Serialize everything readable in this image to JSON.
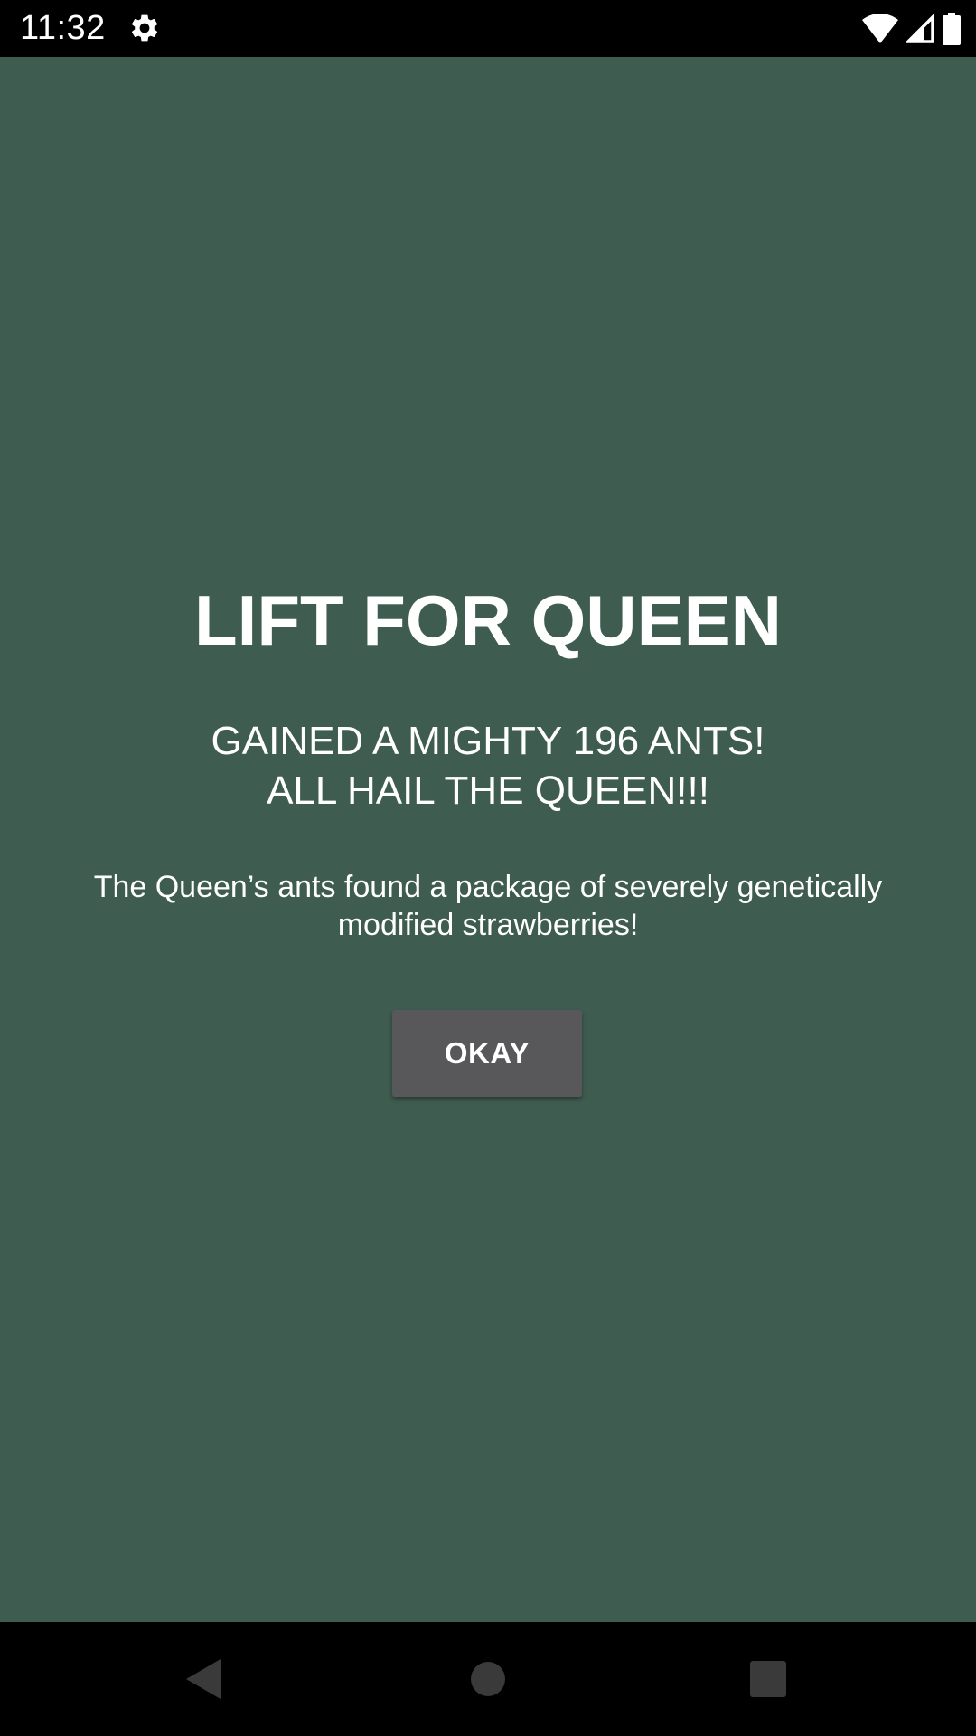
{
  "status_bar": {
    "time": "11:32",
    "icons": [
      "gear-icon",
      "wifi-icon",
      "cellular-signal-icon",
      "battery-icon"
    ]
  },
  "dialog": {
    "title": "LIFT FOR QUEEN",
    "subtitle_line1": "GAINED A MIGHTY 196 ANTS!",
    "subtitle_line2": "ALL HAIL THE QUEEN!!!",
    "description": "The Queen’s ants found a package of severely genetically modified strawberries!",
    "button_label": "OKAY"
  },
  "nav_bar": {
    "icons": [
      "back-icon",
      "home-icon",
      "recents-icon"
    ]
  },
  "colors": {
    "background": "#3f5c50",
    "button": "#58585a",
    "text": "#ffffff",
    "system_bars": "#000000"
  }
}
